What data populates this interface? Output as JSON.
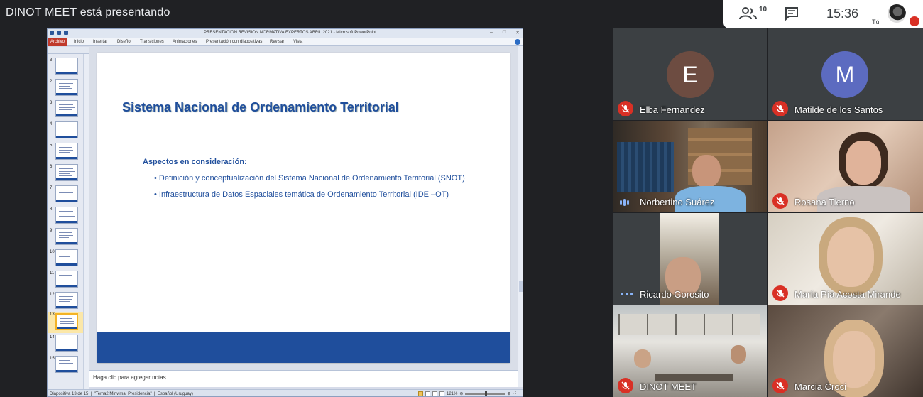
{
  "meeting": {
    "presenting_banner": "DINOT MEET está presentando",
    "people_count": "10",
    "clock": "15:36",
    "self_label": "Tú"
  },
  "powerpoint": {
    "window_title": "PRESENTACION REVISION NORMATIVA EXPERTOS ABRIL 2021  -  Microsoft PowerPoint",
    "ribbon_tabs": [
      "Archivo",
      "Inicio",
      "Insertar",
      "Diseño",
      "Transiciones",
      "Animaciones",
      "Presentación con diapositivas",
      "Revisar",
      "Vista"
    ],
    "thumbnails": [
      "3",
      "2",
      "3",
      "4",
      "5",
      "6",
      "7",
      "8",
      "9",
      "10",
      "11",
      "12",
      "13",
      "14",
      "15"
    ],
    "active_thumbnail": "13",
    "slide": {
      "title": "Sistema Nacional de Ordenamiento Territorial",
      "subheading": "Aspectos en consideración:",
      "bullets": [
        "• Definición y conceptualización del Sistema Nacional de Ordenamiento Territorial (SNOT)",
        "• Infraestructura de Datos Espaciales temática de Ordenamiento Territorial (IDE –OT)"
      ]
    },
    "notes_placeholder": "Haga clic para agregar notas",
    "status_bar": {
      "slide_info": "Diapositiva 13 de 15",
      "theme": "\"Tema2 Minvima_Presidencia\"",
      "language": "Español (Uruguay)",
      "zoom": "121%"
    }
  },
  "participants": [
    {
      "name": "Elba Fernandez",
      "initial": "E",
      "avatar_color": "#6d4c41",
      "mic": "muted"
    },
    {
      "name": "Matilde de los Santos",
      "initial": "M",
      "avatar_color": "#5c6bc0",
      "mic": "muted"
    },
    {
      "name": "Norbertino Suárez",
      "mic": "speaking"
    },
    {
      "name": "Rosana Tierno",
      "mic": "muted"
    },
    {
      "name": "Ricardo Gorosito",
      "mic": "more"
    },
    {
      "name": "María Pía Acosta Mirande",
      "mic": "muted"
    },
    {
      "name": "DINOT MEET",
      "mic": "muted"
    },
    {
      "name": "Marcia Croci",
      "mic": "muted"
    }
  ]
}
